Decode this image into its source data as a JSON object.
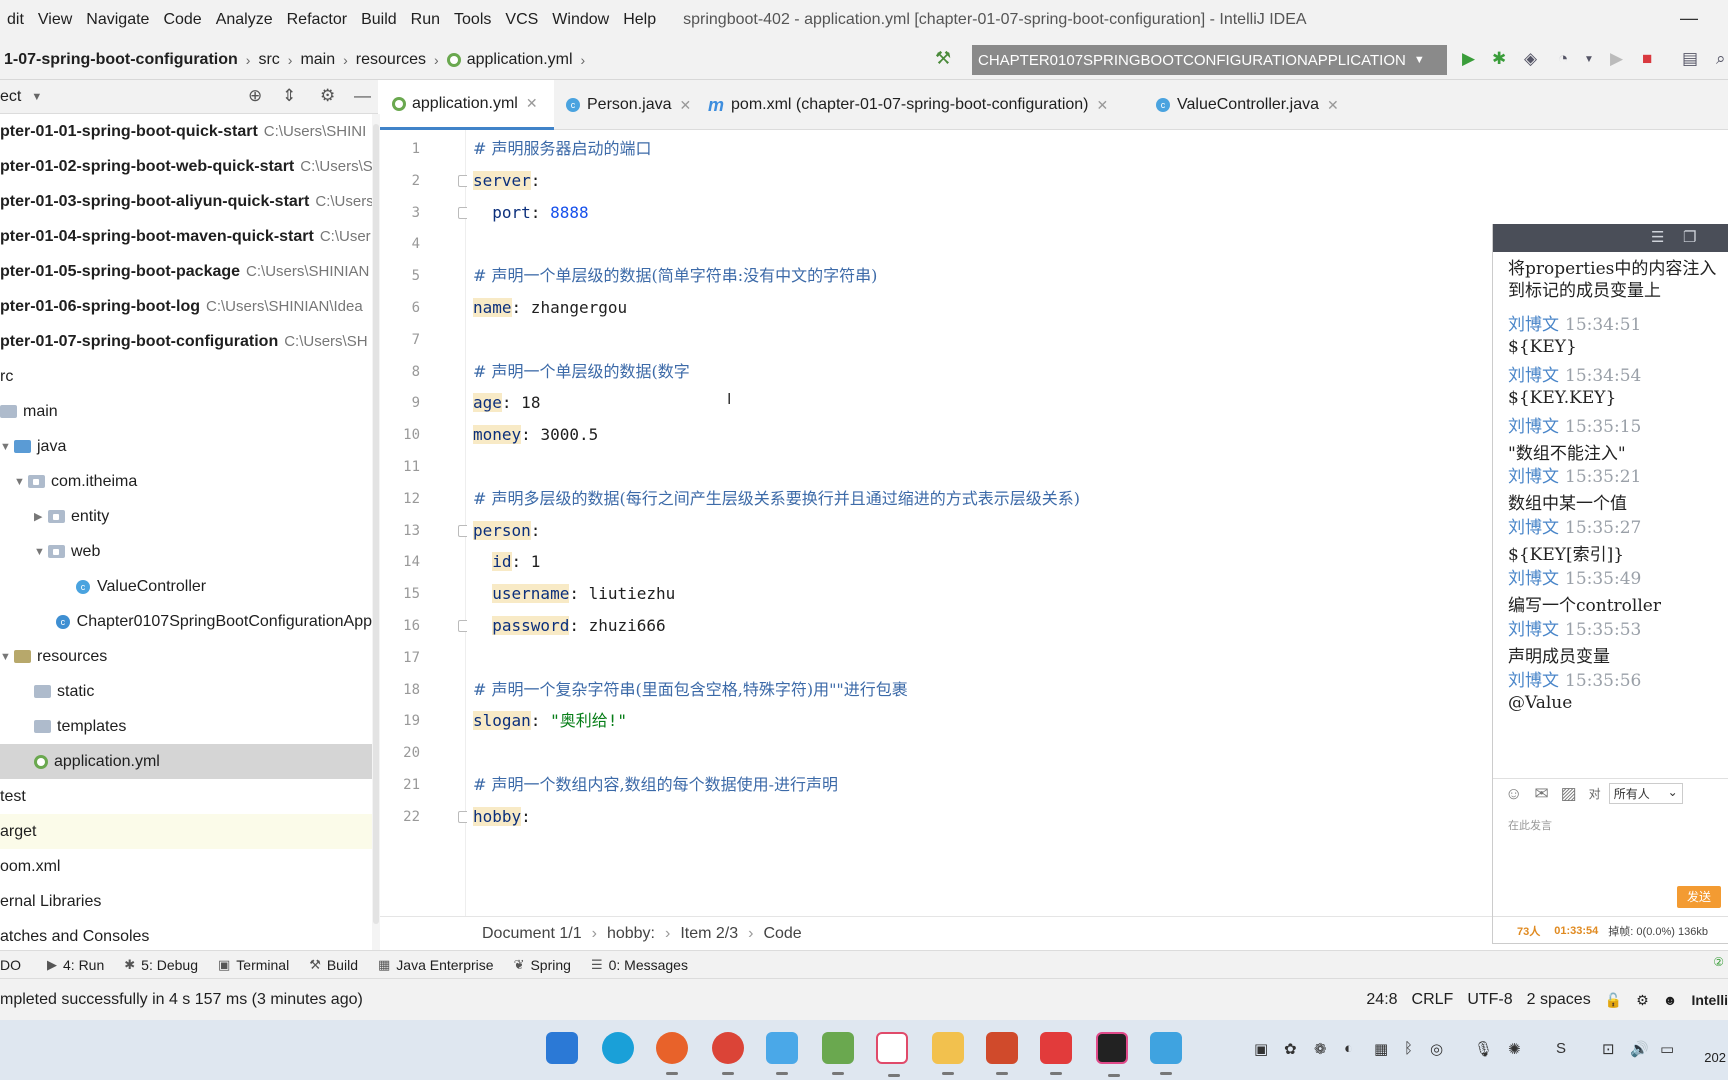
{
  "menubar": {
    "items": [
      "dit",
      "View",
      "Navigate",
      "Code",
      "Analyze",
      "Refactor",
      "Build",
      "Run",
      "Tools",
      "VCS",
      "Window",
      "Help"
    ],
    "title": "springboot-402 - application.yml [chapter-01-07-spring-boot-configuration] - IntelliJ IDEA",
    "minimize": "—"
  },
  "navbar": {
    "crumbs": [
      "1-07-spring-boot-configuration",
      "src",
      "main",
      "resources",
      "application.yml"
    ],
    "run_config": "CHAPTER0107SPRINGBOOTCONFIGURATIONAPPLICATION"
  },
  "project": {
    "header": "ect",
    "tree": [
      {
        "label": "pter-01-01-spring-boot-quick-start",
        "path": "C:\\Users\\SHINI"
      },
      {
        "label": "pter-01-02-spring-boot-web-quick-start",
        "path": "C:\\Users\\S"
      },
      {
        "label": "pter-01-03-spring-boot-aliyun-quick-start",
        "path": "C:\\Users"
      },
      {
        "label": "pter-01-04-spring-boot-maven-quick-start",
        "path": "C:\\User"
      },
      {
        "label": "pter-01-05-spring-boot-package",
        "path": "C:\\Users\\SHINIAN"
      },
      {
        "label": "pter-01-06-spring-boot-log",
        "path": "C:\\Users\\SHINIAN\\Idea"
      },
      {
        "label": "pter-01-07-spring-boot-configuration",
        "path": "C:\\Users\\SH"
      },
      {
        "label": "rc"
      },
      {
        "label": "main"
      },
      {
        "label": "java"
      },
      {
        "label": "com.itheima"
      },
      {
        "label": "entity"
      },
      {
        "label": "web"
      },
      {
        "label": "ValueController"
      },
      {
        "label": "Chapter0107SpringBootConfigurationApp"
      },
      {
        "label": "resources"
      },
      {
        "label": "static"
      },
      {
        "label": "templates"
      },
      {
        "label": "application.yml"
      },
      {
        "label": "test"
      },
      {
        "label": "arget"
      },
      {
        "label": "oom.xml"
      },
      {
        "label": "ernal Libraries"
      },
      {
        "label": "atches and Consoles"
      }
    ]
  },
  "tabs": [
    {
      "label": "application.yml",
      "active": true
    },
    {
      "label": "Person.java"
    },
    {
      "label": "pom.xml (chapter-01-07-spring-boot-configuration)"
    },
    {
      "label": "ValueController.java"
    }
  ],
  "editor": {
    "lines": [
      {
        "n": "1",
        "comment": "# 声明服务器启动的端口"
      },
      {
        "n": "2",
        "key": "server",
        "val": ""
      },
      {
        "n": "3",
        "indent": "  ",
        "plainkey": "port",
        "num": "8888"
      },
      {
        "n": "4"
      },
      {
        "n": "5",
        "comment": "# 声明一个单层级的数据(简单字符串:没有中文的字符串)"
      },
      {
        "n": "6",
        "key": "name",
        "val": " zhangergou"
      },
      {
        "n": "7"
      },
      {
        "n": "8",
        "comment": "# 声明一个单层级的数据(数字"
      },
      {
        "n": "9",
        "key": "age",
        "val": " 18"
      },
      {
        "n": "10",
        "key": "money",
        "val": " 3000.5"
      },
      {
        "n": "11"
      },
      {
        "n": "12",
        "comment": "# 声明多层级的数据(每行之间产生层级关系要换行并且通过缩进的方式表示层级关系)"
      },
      {
        "n": "13",
        "key": "person",
        "val": ""
      },
      {
        "n": "14",
        "indent": "  ",
        "key": "id",
        "val": " 1"
      },
      {
        "n": "15",
        "indent": "  ",
        "key": "username",
        "val": " liutiezhu"
      },
      {
        "n": "16",
        "indent": "  ",
        "key": "password",
        "val": " zhuzi666"
      },
      {
        "n": "17"
      },
      {
        "n": "18",
        "comment": "# 声明一个复杂字符串(里面包含空格,特殊字符)用\"\"进行包裹"
      },
      {
        "n": "19",
        "key": "slogan",
        "str": " \"奥利给!\""
      },
      {
        "n": "20"
      },
      {
        "n": "21",
        "comment": "# 声明一个数组内容,数组的每个数据使用-进行声明"
      },
      {
        "n": "22",
        "key": "hobby",
        "val": ""
      }
    ],
    "breadcrumb": [
      "Document 1/1",
      "hobby:",
      "Item 2/3",
      "Code"
    ]
  },
  "chat": {
    "first": "将properties中的内容注入到标记的成员变量上",
    "messages": [
      {
        "who": "刘博文",
        "time": "15:34:51",
        "text": "${KEY}"
      },
      {
        "who": "刘博文",
        "time": "15:34:54",
        "text": "${KEY.KEY}"
      },
      {
        "who": "刘博文",
        "time": "15:35:15",
        "text": "\"数组不能注入\""
      },
      {
        "who": "刘博文",
        "time": "15:35:21",
        "text": "数组中某一个值"
      },
      {
        "who": "刘博文",
        "time": "15:35:27",
        "text": "${KEY[索引]}"
      },
      {
        "who": "刘博文",
        "time": "15:35:49",
        "text": "编写一个controller"
      },
      {
        "who": "刘博文",
        "time": "15:35:53",
        "text": "声明成员变量"
      },
      {
        "who": "刘博文",
        "time": "15:35:56",
        "text": "@Value"
      }
    ],
    "to_label": "对",
    "to_value": "所有人",
    "placeholder": "在此发言",
    "send": "发送",
    "count": "73人",
    "clock": "01:33:54",
    "lost": "掉帧: 0(0.0%) 136kb"
  },
  "toolwindows": [
    {
      "icon": "",
      "label": "DO"
    },
    {
      "icon": "▶",
      "label": "4: Run"
    },
    {
      "icon": "✱",
      "label": "5: Debug"
    },
    {
      "icon": "▣",
      "label": "Terminal"
    },
    {
      "icon": "⚒",
      "label": "Build"
    },
    {
      "icon": "▦",
      "label": "Java Enterprise"
    },
    {
      "icon": "❦",
      "label": "Spring"
    },
    {
      "icon": "☰",
      "label": "0: Messages"
    }
  ],
  "status": {
    "message": "mpleted successfully in 4 s 157 ms (3 minutes ago)",
    "position": "24:8",
    "line_sep": "CRLF",
    "encoding": "UTF-8",
    "indent": "2 spaces",
    "brand": "Intelli"
  },
  "taskbar": {
    "clock": "202"
  },
  "colors": {
    "accent": "#4083c9",
    "run_green": "#3a9d3a",
    "stop_red": "#d9393f",
    "key_highlight": "#f8eac6",
    "chat_name": "#4a86c9",
    "send_orange": "#f39b32"
  }
}
